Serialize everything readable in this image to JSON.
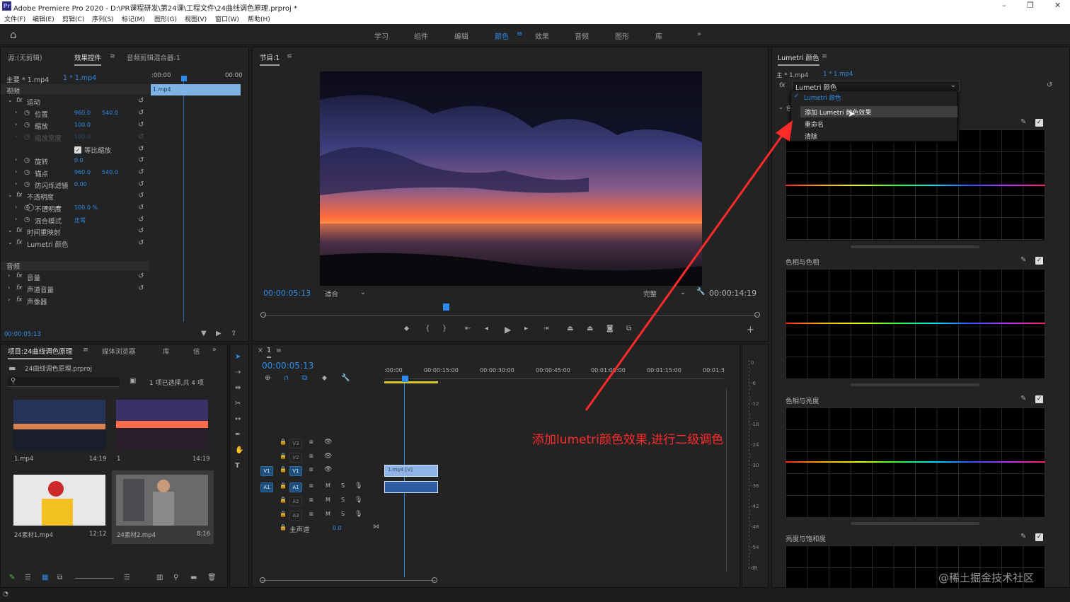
{
  "app": {
    "title": "Adobe Premiere Pro 2020 - D:\\PR课程研发\\第24课\\工程文件\\24曲线调色原理.prproj *",
    "logo": "Pr"
  },
  "menu": [
    "文件(F)",
    "编辑(E)",
    "剪辑(C)",
    "序列(S)",
    "标记(M)",
    "图形(G)",
    "视图(V)",
    "窗口(W)",
    "帮助(H)"
  ],
  "workspaces": [
    "学习",
    "组件",
    "编辑",
    "颜色",
    "效果",
    "音频",
    "图形",
    "库"
  ],
  "active_workspace": "颜色",
  "effects_panel": {
    "tabs": [
      "源:(无剪辑)",
      "效果控件",
      "音频剪辑混合器:1"
    ],
    "master": "主要 * 1.mp4",
    "clip": "1 * 1.mp4",
    "ruler": {
      "start": ":00:00",
      "end": "00:00"
    },
    "clip_label": "1.mp4",
    "sections": {
      "video": "视频",
      "audio": "音频"
    },
    "rows": [
      {
        "label": "运动",
        "type": "fx"
      },
      {
        "label": "位置",
        "v1": "960.0",
        "v2": "540.0"
      },
      {
        "label": "缩放",
        "v1": "100.0"
      },
      {
        "label": "缩放宽度",
        "v1": "100.0",
        "dim": true
      },
      {
        "label": "等比缩放",
        "type": "check"
      },
      {
        "label": "旋转",
        "v1": "0.0"
      },
      {
        "label": "锚点",
        "v1": "960.0",
        "v2": "540.0"
      },
      {
        "label": "防闪烁滤镜",
        "v1": "0.00"
      },
      {
        "label": "不透明度",
        "type": "fx"
      },
      {
        "label": "不透明度",
        "v1": "100.0 %"
      },
      {
        "label": "混合模式",
        "v1": "正常"
      },
      {
        "label": "时间重映射",
        "type": "fx"
      },
      {
        "label": "Lumetri 颜色",
        "type": "fx"
      }
    ],
    "audio_rows": [
      "音量",
      "声道音量",
      "声像器"
    ],
    "timecode": "00:00:05:13"
  },
  "program": {
    "title": "节目:1",
    "timecode": "00:00:05:13",
    "fit": "适合",
    "quality": "完整",
    "duration": "00:00:14:19"
  },
  "project": {
    "tabs": [
      "项目:24曲线调色原理",
      "媒体浏览器",
      "库",
      "信"
    ],
    "file": "24曲线调色原理.prproj",
    "selection": "1 项已选择,共 4 项",
    "items": [
      {
        "name": "1.mp4",
        "dur": "14:19"
      },
      {
        "name": "1",
        "dur": "14:19"
      },
      {
        "name": "24素材1.mp4",
        "dur": "12:12"
      },
      {
        "name": "24素材2.mp4",
        "dur": "8:16"
      }
    ]
  },
  "timeline": {
    "tab": "1",
    "timecode": "00:00:05:13",
    "ruler": [
      ":00:00",
      "00:00:15:00",
      "00:00:30:00",
      "00:00:45:00",
      "00:01:00:00",
      "00:01:15:00",
      "00:01:3"
    ],
    "tracks": [
      "V3",
      "V2",
      "V1",
      "A1",
      "A2",
      "A3"
    ],
    "master": "主声道",
    "master_val": "0.0",
    "clip_v": "1.mp4 [V]",
    "meter": [
      "0",
      "-6",
      "-12",
      "-18",
      "-24",
      "-30",
      "-36",
      "-42",
      "-48",
      "-54",
      "dB"
    ]
  },
  "lumetri": {
    "title": "Lumetri 颜色",
    "master": "主 * 1.mp4",
    "clip": "1 * 1.mp4",
    "effect": "Lumetri 颜色",
    "menu": {
      "checked": "Lumetri 颜色",
      "items": [
        "添加 Lumetri 颜色效果",
        "重命名",
        "清除"
      ]
    },
    "sections": [
      "色相与色相",
      "色相与亮度",
      "亮度与饱和度"
    ],
    "collapsed_label": "色"
  },
  "annotation": "添加lumetri颜色效果,进行二级调色",
  "watermark": "@稀土掘金技术社区",
  "colors": {
    "accent": "#2d8ceb",
    "annotation": "#ff2a2a"
  }
}
